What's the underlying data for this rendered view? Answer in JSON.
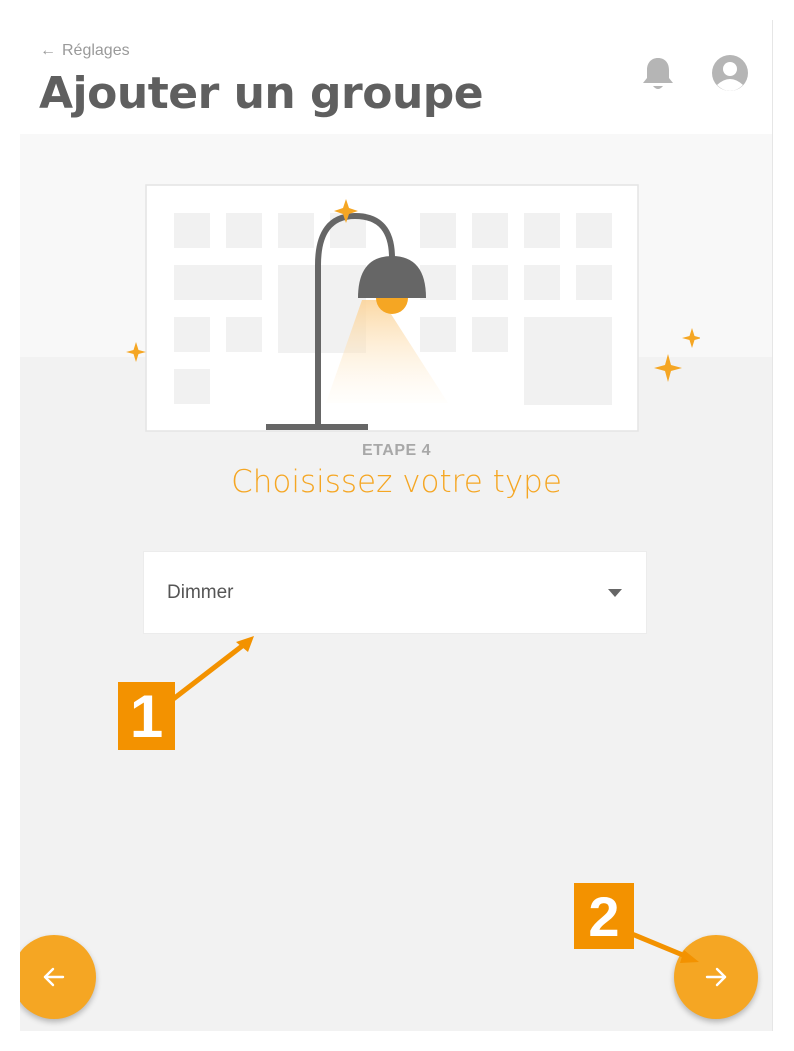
{
  "header": {
    "back_label": "Réglages",
    "title": "Ajouter un groupe",
    "icons": [
      "bell-icon",
      "user-icon",
      "arrow-left-icon"
    ]
  },
  "step": {
    "label": "ETAPE 4",
    "title": "Choisissez votre type"
  },
  "type_select": {
    "value": "Dimmer"
  },
  "navigation": {
    "prev_icon": "arrow-left-icon",
    "next_icon": "arrow-right-icon"
  },
  "annotations": {
    "callout_1": "1",
    "callout_2": "2"
  },
  "colors": {
    "accent": "#f5a623",
    "callout": "#f39200",
    "title": "#5f5f5f",
    "background": "#f2f2f2"
  }
}
